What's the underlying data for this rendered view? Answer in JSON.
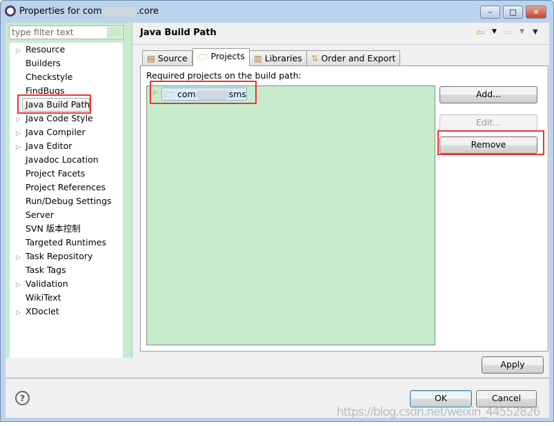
{
  "window": {
    "title_prefix": "Properties for com",
    "title_suffix": ".core",
    "minimize": "–",
    "maximize": "□",
    "close": "✕"
  },
  "sidebar": {
    "filter_placeholder": "type filter text",
    "items": [
      {
        "label": "Resource",
        "expandable": true
      },
      {
        "label": "Builders",
        "expandable": false
      },
      {
        "label": "Checkstyle",
        "expandable": false
      },
      {
        "label": "FindBugs",
        "expandable": false
      },
      {
        "label": "Java Build Path",
        "expandable": false,
        "selected": true
      },
      {
        "label": "Java Code Style",
        "expandable": true
      },
      {
        "label": "Java Compiler",
        "expandable": true
      },
      {
        "label": "Java Editor",
        "expandable": true
      },
      {
        "label": "Javadoc Location",
        "expandable": false
      },
      {
        "label": "Project Facets",
        "expandable": false
      },
      {
        "label": "Project References",
        "expandable": false
      },
      {
        "label": "Run/Debug Settings",
        "expandable": false
      },
      {
        "label": "Server",
        "expandable": false
      },
      {
        "label": "SVN 版本控制",
        "expandable": false
      },
      {
        "label": "Targeted Runtimes",
        "expandable": false
      },
      {
        "label": "Task Repository",
        "expandable": true
      },
      {
        "label": "Task Tags",
        "expandable": false
      },
      {
        "label": "Validation",
        "expandable": true
      },
      {
        "label": "WikiText",
        "expandable": false
      },
      {
        "label": "XDoclet",
        "expandable": true
      }
    ]
  },
  "main": {
    "title": "Java Build Path",
    "tabs": [
      {
        "label": "Source"
      },
      {
        "label": "Projects",
        "active": true
      },
      {
        "label": "Libraries"
      },
      {
        "label": "Order and Export"
      }
    ],
    "required_label": "Required projects on the build path:",
    "projects": [
      {
        "prefix": "com",
        "suffix": "sms"
      }
    ],
    "buttons": {
      "add": "Add...",
      "edit": "Edit...",
      "remove": "Remove",
      "apply": "Apply"
    }
  },
  "footer": {
    "ok": "OK",
    "cancel": "Cancel",
    "help": "?"
  },
  "watermark": "https://blog.csdn.net/weixin_44552826",
  "colors": {
    "highlight": "#f03232",
    "list_bg": "#c7ebcb"
  }
}
